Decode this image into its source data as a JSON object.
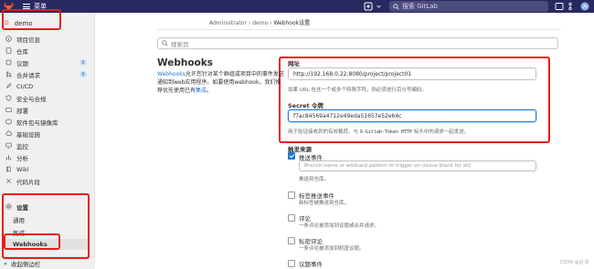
{
  "topbar": {
    "menu_label": "菜单",
    "search_placeholder": "搜索 GitLab"
  },
  "sidebar": {
    "project_letter": "D",
    "project_name": "demo",
    "items": [
      {
        "label": "项目信息",
        "icon": "info-icon"
      },
      {
        "label": "仓库",
        "icon": "repository-icon"
      },
      {
        "label": "议题",
        "icon": "issues-icon",
        "badge": "0"
      },
      {
        "label": "合并请求",
        "icon": "merge-request-icon",
        "badge": "0"
      },
      {
        "label": "CI/CD",
        "icon": "rocket-icon"
      },
      {
        "label": "安全与合规",
        "icon": "shield-icon"
      },
      {
        "label": "部署",
        "icon": "deployments-icon"
      },
      {
        "label": "软件包与镜像库",
        "icon": "package-icon"
      },
      {
        "label": "基础设施",
        "icon": "cloud-icon"
      },
      {
        "label": "监控",
        "icon": "monitor-icon"
      },
      {
        "label": "分析",
        "icon": "chart-icon"
      },
      {
        "label": "Wiki",
        "icon": "book-icon"
      },
      {
        "label": "代码片段",
        "icon": "snippet-icon"
      },
      {
        "label": "设置",
        "icon": "gear-icon"
      }
    ],
    "subitems": [
      "通用",
      "集成",
      "Webhooks"
    ],
    "collapse_label": "收起侧边栏"
  },
  "breadcrumb": {
    "root": "Administrator",
    "project": "demo",
    "current": "Webhook设置"
  },
  "page": {
    "search_placeholder": "搜索页",
    "title": "Webhooks",
    "description_link": "Webhooks",
    "description_text": "允许您针对某个群组或项目中的事件发送通知到web应用程序。如要使用webhook，我们推荐优先使用已有",
    "description_link2": "集成",
    "description_end": "。"
  },
  "form": {
    "url_label": "网址",
    "url_value": "http://192.168.0.22:8080/project/project01",
    "url_help": "如果 URL 包含一个或多个特殊字符，则必须进行百分号编码。",
    "secret_label": "Secret 令牌",
    "secret_value": "f7ac84569a4712e49eda51657e52e64c",
    "secret_help_prefix": "用于验证接收到的有效载荷。与",
    "secret_help_code": "X-Gitlab-Token HTTP",
    "secret_help_suffix": "标头中的请求一起发送。",
    "trigger_label": "触发来源",
    "push_label": "推送事件",
    "branch_placeholder": "Branch name or wildcard pattern to trigger on (leave blank for all)",
    "push_help": "推送到仓库。",
    "tag_label": "标签推送事件",
    "tag_help": "新标签被推送到仓库。",
    "comment_label": "评论",
    "comment_help": "一条评论被添加到议题或合并请求。",
    "confidential_label": "私密评论",
    "confidential_help": "一条评论被添加到机密议题。",
    "issues_label": "议题事件"
  },
  "watermark": "CSDN @进 阶"
}
